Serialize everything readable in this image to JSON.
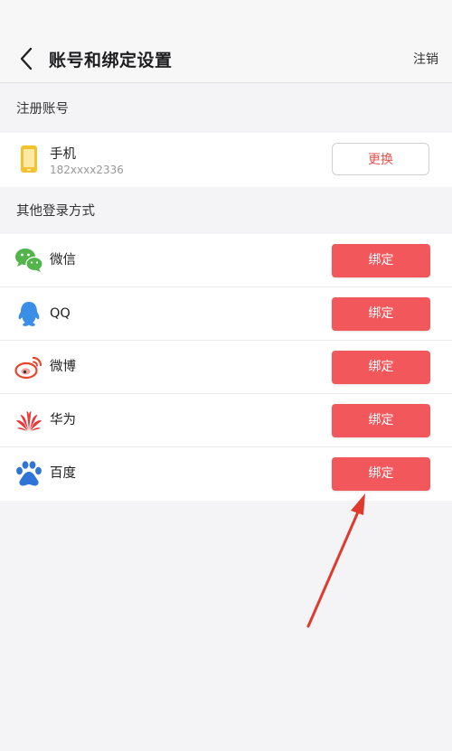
{
  "header": {
    "title": "账号和绑定设置",
    "logout_label": "注销",
    "back_icon": "chevron-left-icon"
  },
  "registered_section": {
    "title": "注册账号",
    "phone": {
      "label": "手机",
      "number": "182xxxx2336",
      "change_label": "更换",
      "icon": "phone-icon",
      "icon_color": "#f2c230"
    }
  },
  "other_section": {
    "title": "其他登录方式",
    "items": [
      {
        "label": "微信",
        "button": "绑定",
        "icon": "wechat-icon",
        "color": "#52b44b"
      },
      {
        "label": "QQ",
        "button": "绑定",
        "icon": "qq-icon",
        "color": "#3a8ee6"
      },
      {
        "label": "微博",
        "button": "绑定",
        "icon": "weibo-icon",
        "color": "#e6452c"
      },
      {
        "label": "华为",
        "button": "绑定",
        "icon": "huawei-icon",
        "color": "#e63a3c"
      },
      {
        "label": "百度",
        "button": "绑定",
        "icon": "baidu-icon",
        "color": "#2f74d7"
      }
    ]
  },
  "colors": {
    "accent": "#f2575b",
    "change_text": "#e9504f",
    "annotation_arrow": "#e03a2f"
  }
}
